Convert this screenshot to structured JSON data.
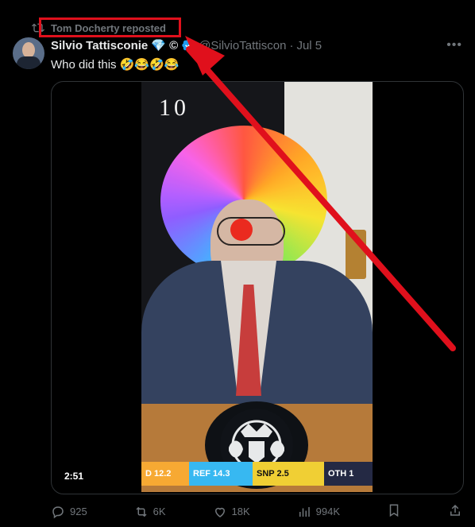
{
  "repost": {
    "text": "Tom Docherty reposted"
  },
  "tweet": {
    "name": "Silvio Tattisconie",
    "name_extra": "💎 ©",
    "handle": "@SilvioTattiscon",
    "dot": "·",
    "date": "Jul 5",
    "text": "Who did this 🤣😂🤣😂"
  },
  "video": {
    "door_number": "10",
    "duration": "2:51",
    "ticker": {
      "t1": "D  12.2",
      "t2": "REF  14.3",
      "t3": "SNP   2.5",
      "t4": "OTH  1"
    }
  },
  "actions": {
    "reply": "925",
    "retweet": "6K",
    "like": "18K",
    "views": "994K"
  },
  "colors": {
    "background": "#000000",
    "muted": "#71767b",
    "annotation": "#e0101c",
    "verified": "#1d9bf0"
  }
}
